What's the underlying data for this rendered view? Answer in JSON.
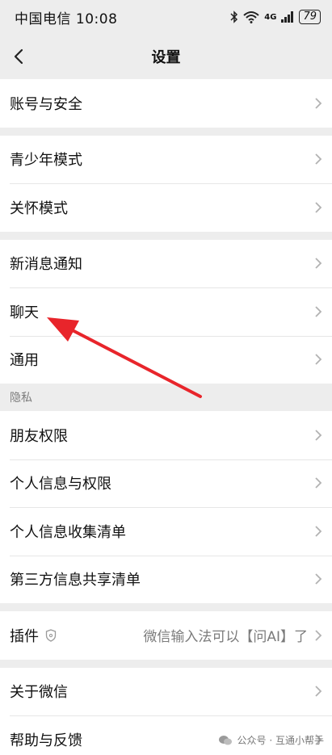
{
  "status": {
    "carrier": "中国电信",
    "time": "10:08",
    "network": "4G",
    "battery": "79"
  },
  "nav": {
    "title": "设置"
  },
  "groups": {
    "account": [
      "账号与安全"
    ],
    "youth": [
      "青少年模式",
      "关怀模式"
    ],
    "general": [
      "新消息通知",
      "聊天",
      "通用"
    ],
    "privacy_header": "隐私",
    "privacy": [
      "朋友权限",
      "个人信息与权限",
      "个人信息收集清单",
      "第三方信息共享清单"
    ],
    "plugins": {
      "label": "插件",
      "value": "微信输入法可以【问AI】了"
    },
    "about": [
      "关于微信",
      "帮助与反馈"
    ]
  },
  "watermark": {
    "text": "公众号 · 互通小帮手"
  },
  "colors": {
    "arrow": "#e8252b",
    "background": "#ededed",
    "row": "#ffffff"
  }
}
